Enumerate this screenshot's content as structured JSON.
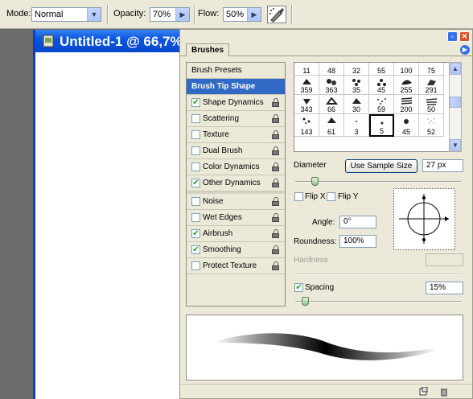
{
  "options_bar": {
    "mode_label": "Mode:",
    "mode_value": "Normal",
    "opacity_label": "Opacity:",
    "opacity_value": "70%",
    "flow_label": "Flow:",
    "flow_value": "50%"
  },
  "document": {
    "title": "Untitled-1 @ 66,7% ("
  },
  "panel": {
    "tab": "Brushes",
    "list": [
      {
        "label": "Brush Presets",
        "checkbox": false,
        "checked": false,
        "lock": false,
        "selected": false
      },
      {
        "label": "Brush Tip Shape",
        "checkbox": false,
        "checked": false,
        "lock": false,
        "selected": true
      },
      {
        "label": "Shape Dynamics",
        "checkbox": true,
        "checked": true,
        "lock": true,
        "selected": false
      },
      {
        "label": "Scattering",
        "checkbox": true,
        "checked": false,
        "lock": true,
        "selected": false
      },
      {
        "label": "Texture",
        "checkbox": true,
        "checked": false,
        "lock": true,
        "selected": false
      },
      {
        "label": "Dual Brush",
        "checkbox": true,
        "checked": false,
        "lock": true,
        "selected": false
      },
      {
        "label": "Color Dynamics",
        "checkbox": true,
        "checked": false,
        "lock": true,
        "selected": false
      },
      {
        "label": "Other Dynamics",
        "checkbox": true,
        "checked": true,
        "lock": true,
        "selected": false
      },
      {
        "label": "Noise",
        "checkbox": true,
        "checked": false,
        "lock": true,
        "selected": false
      },
      {
        "label": "Wet Edges",
        "checkbox": true,
        "checked": false,
        "lock": true,
        "selected": false
      },
      {
        "label": "Airbrush",
        "checkbox": true,
        "checked": true,
        "lock": true,
        "selected": false
      },
      {
        "label": "Smoothing",
        "checkbox": true,
        "checked": true,
        "lock": true,
        "selected": false
      },
      {
        "label": "Protect Texture",
        "checkbox": true,
        "checked": false,
        "lock": true,
        "selected": false
      }
    ],
    "brush_grid": [
      [
        "11",
        "48",
        "32",
        "55",
        "100",
        "75"
      ],
      [
        "359",
        "363",
        "35",
        "45",
        "255",
        "291"
      ],
      [
        "343",
        "66",
        "30",
        "59",
        "200",
        "50"
      ],
      [
        "143",
        "61",
        "3",
        "5",
        "45",
        "52"
      ]
    ],
    "selected_brush": "5",
    "diameter_label": "Diameter",
    "use_sample_size": "Use Sample Size",
    "diameter_value": "27 px",
    "flip_x": "Flip X",
    "flip_y": "Flip Y",
    "angle_label": "Angle:",
    "angle_value": "0°",
    "roundness_label": "Roundness:",
    "roundness_value": "100%",
    "hardness_label": "Hardness",
    "spacing_label": "Spacing",
    "spacing_value": "15%"
  }
}
